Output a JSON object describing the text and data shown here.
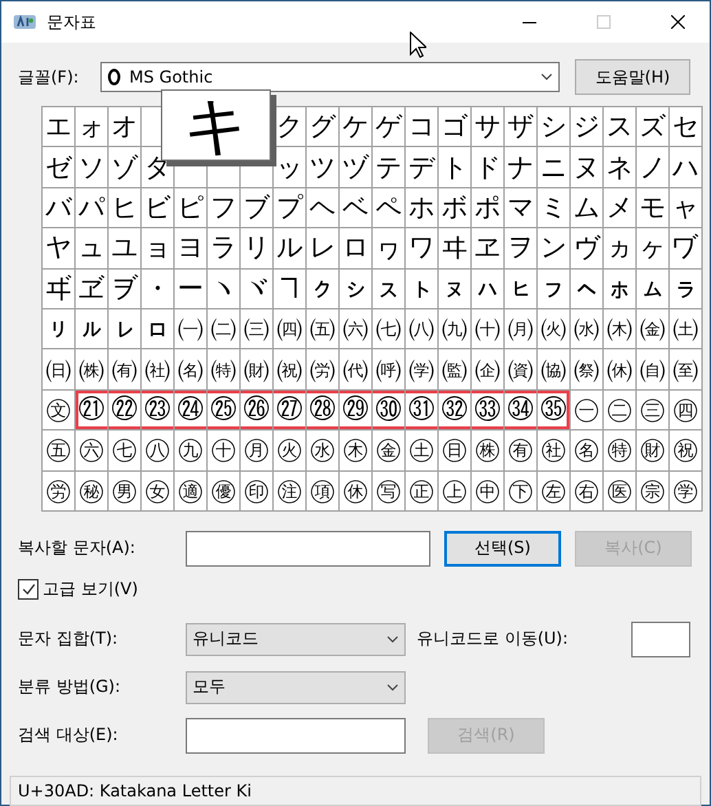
{
  "window": {
    "title": "문자표"
  },
  "font": {
    "label": "글꼴(F):",
    "value": "MS Gothic",
    "help_button": "도움말(H)"
  },
  "grid": {
    "preview": "キ",
    "rows": [
      [
        "エ",
        "ォ",
        "オ",
        null,
        null,
        null,
        null,
        "ク",
        "グ",
        "ケ",
        "ゲ",
        "コ",
        "ゴ",
        "サ",
        "ザ",
        "シ",
        "ジ",
        "ス",
        "ズ",
        "セ"
      ],
      [
        "ゼ",
        "ソ",
        "ゾ",
        "タ",
        null,
        null,
        null,
        "ッ",
        "ツ",
        "ヅ",
        "テ",
        "デ",
        "ト",
        "ド",
        "ナ",
        "ニ",
        "ヌ",
        "ネ",
        "ノ",
        "ハ"
      ],
      [
        "バ",
        "パ",
        "ヒ",
        "ビ",
        "ピ",
        "フ",
        "ブ",
        "プ",
        "ヘ",
        "ベ",
        "ペ",
        "ホ",
        "ボ",
        "ポ",
        "マ",
        "ミ",
        "ム",
        "メ",
        "モ",
        "ャ"
      ],
      [
        "ヤ",
        "ュ",
        "ユ",
        "ョ",
        "ヨ",
        "ラ",
        "リ",
        "ル",
        "レ",
        "ロ",
        "ヮ",
        "ワ",
        "ヰ",
        "ヱ",
        "ヲ",
        "ン",
        "ヴ",
        "ヵ",
        "ヶ",
        "ヷ"
      ],
      [
        "ヸ",
        "ヹ",
        "ヺ",
        "・",
        "ー",
        "ヽ",
        "ヾ",
        "ヿ",
        "ㇰ",
        "ㇱ",
        "ㇲ",
        "ㇳ",
        "ㇴ",
        "ㇵ",
        "ㇶ",
        "ㇷ",
        "ㇸ",
        "ㇹ",
        "ㇺ",
        "ㇻ"
      ],
      [
        "ㇼ",
        "ㇽ",
        "ㇾ",
        "ㇿ",
        "㈠",
        "㈡",
        "㈢",
        "㈣",
        "㈤",
        "㈥",
        "㈦",
        "㈧",
        "㈨",
        "㈩",
        "㈪",
        "㈫",
        "㈬",
        "㈭",
        "㈮",
        "㈯"
      ],
      [
        "㈰",
        "㈱",
        "㈲",
        "㈳",
        "㈴",
        "㈵",
        "㈶",
        "㈷",
        "㈸",
        "㈹",
        "㈺",
        "㈻",
        "㈼",
        "㈽",
        "㈾",
        "㈿",
        "㉀",
        "㉁",
        "㉂",
        "㉃"
      ],
      [
        {
          "char": "㉆",
          "marked": false
        },
        {
          "char": "㉑",
          "marked": true
        },
        {
          "char": "㉒",
          "marked": true
        },
        {
          "char": "㉓",
          "marked": true
        },
        {
          "char": "㉔",
          "marked": true
        },
        {
          "char": "㉕",
          "marked": true
        },
        {
          "char": "㉖",
          "marked": true
        },
        {
          "char": "㉗",
          "marked": true
        },
        {
          "char": "㉘",
          "marked": true
        },
        {
          "char": "㉙",
          "marked": true
        },
        {
          "char": "㉚",
          "marked": true
        },
        {
          "char": "㉛",
          "marked": true
        },
        {
          "char": "㉜",
          "marked": true
        },
        {
          "char": "㉝",
          "marked": true
        },
        {
          "char": "㉞",
          "marked": true
        },
        {
          "char": "㉟",
          "marked": true
        },
        {
          "char": "㊀",
          "marked": false
        },
        {
          "char": "㊁",
          "marked": false
        },
        {
          "char": "㊂",
          "marked": false
        },
        {
          "char": "㊃",
          "marked": false
        }
      ],
      [
        "㊄",
        "㊅",
        "㊆",
        "㊇",
        "㊈",
        "㊉",
        "㊊",
        "㊋",
        "㊌",
        "㊍",
        "㊎",
        "㊏",
        "㊐",
        "㊑",
        "㊒",
        "㊓",
        "㊔",
        "㊕",
        "㊖",
        "㊗"
      ],
      [
        "㊘",
        "㊙",
        "㊚",
        "㊛",
        "㊜",
        "㊝",
        "㊞",
        "㊟",
        "㊠",
        "㊡",
        "㊢",
        "㊣",
        "㊤",
        "㊥",
        "㊦",
        "㊧",
        "㊨",
        "㊩",
        "㊪",
        "㊫"
      ]
    ]
  },
  "copy": {
    "label": "복사할 문자(A):",
    "select_button": "선택(S)",
    "copy_button": "복사(C)",
    "copy_disabled": true
  },
  "advanced": {
    "label": "고급 보기(V)",
    "checked": true
  },
  "charset": {
    "label": "문자 집합(T):",
    "value": "유니코드",
    "goto_label": "유니코드로 이동(U):"
  },
  "group_by": {
    "label": "분류 방법(G):",
    "value": "모두"
  },
  "search": {
    "label": "검색 대상(E):",
    "button": "검색(R)",
    "disabled": true
  },
  "status_bar": "U+30AD: Katakana Letter Ki"
}
